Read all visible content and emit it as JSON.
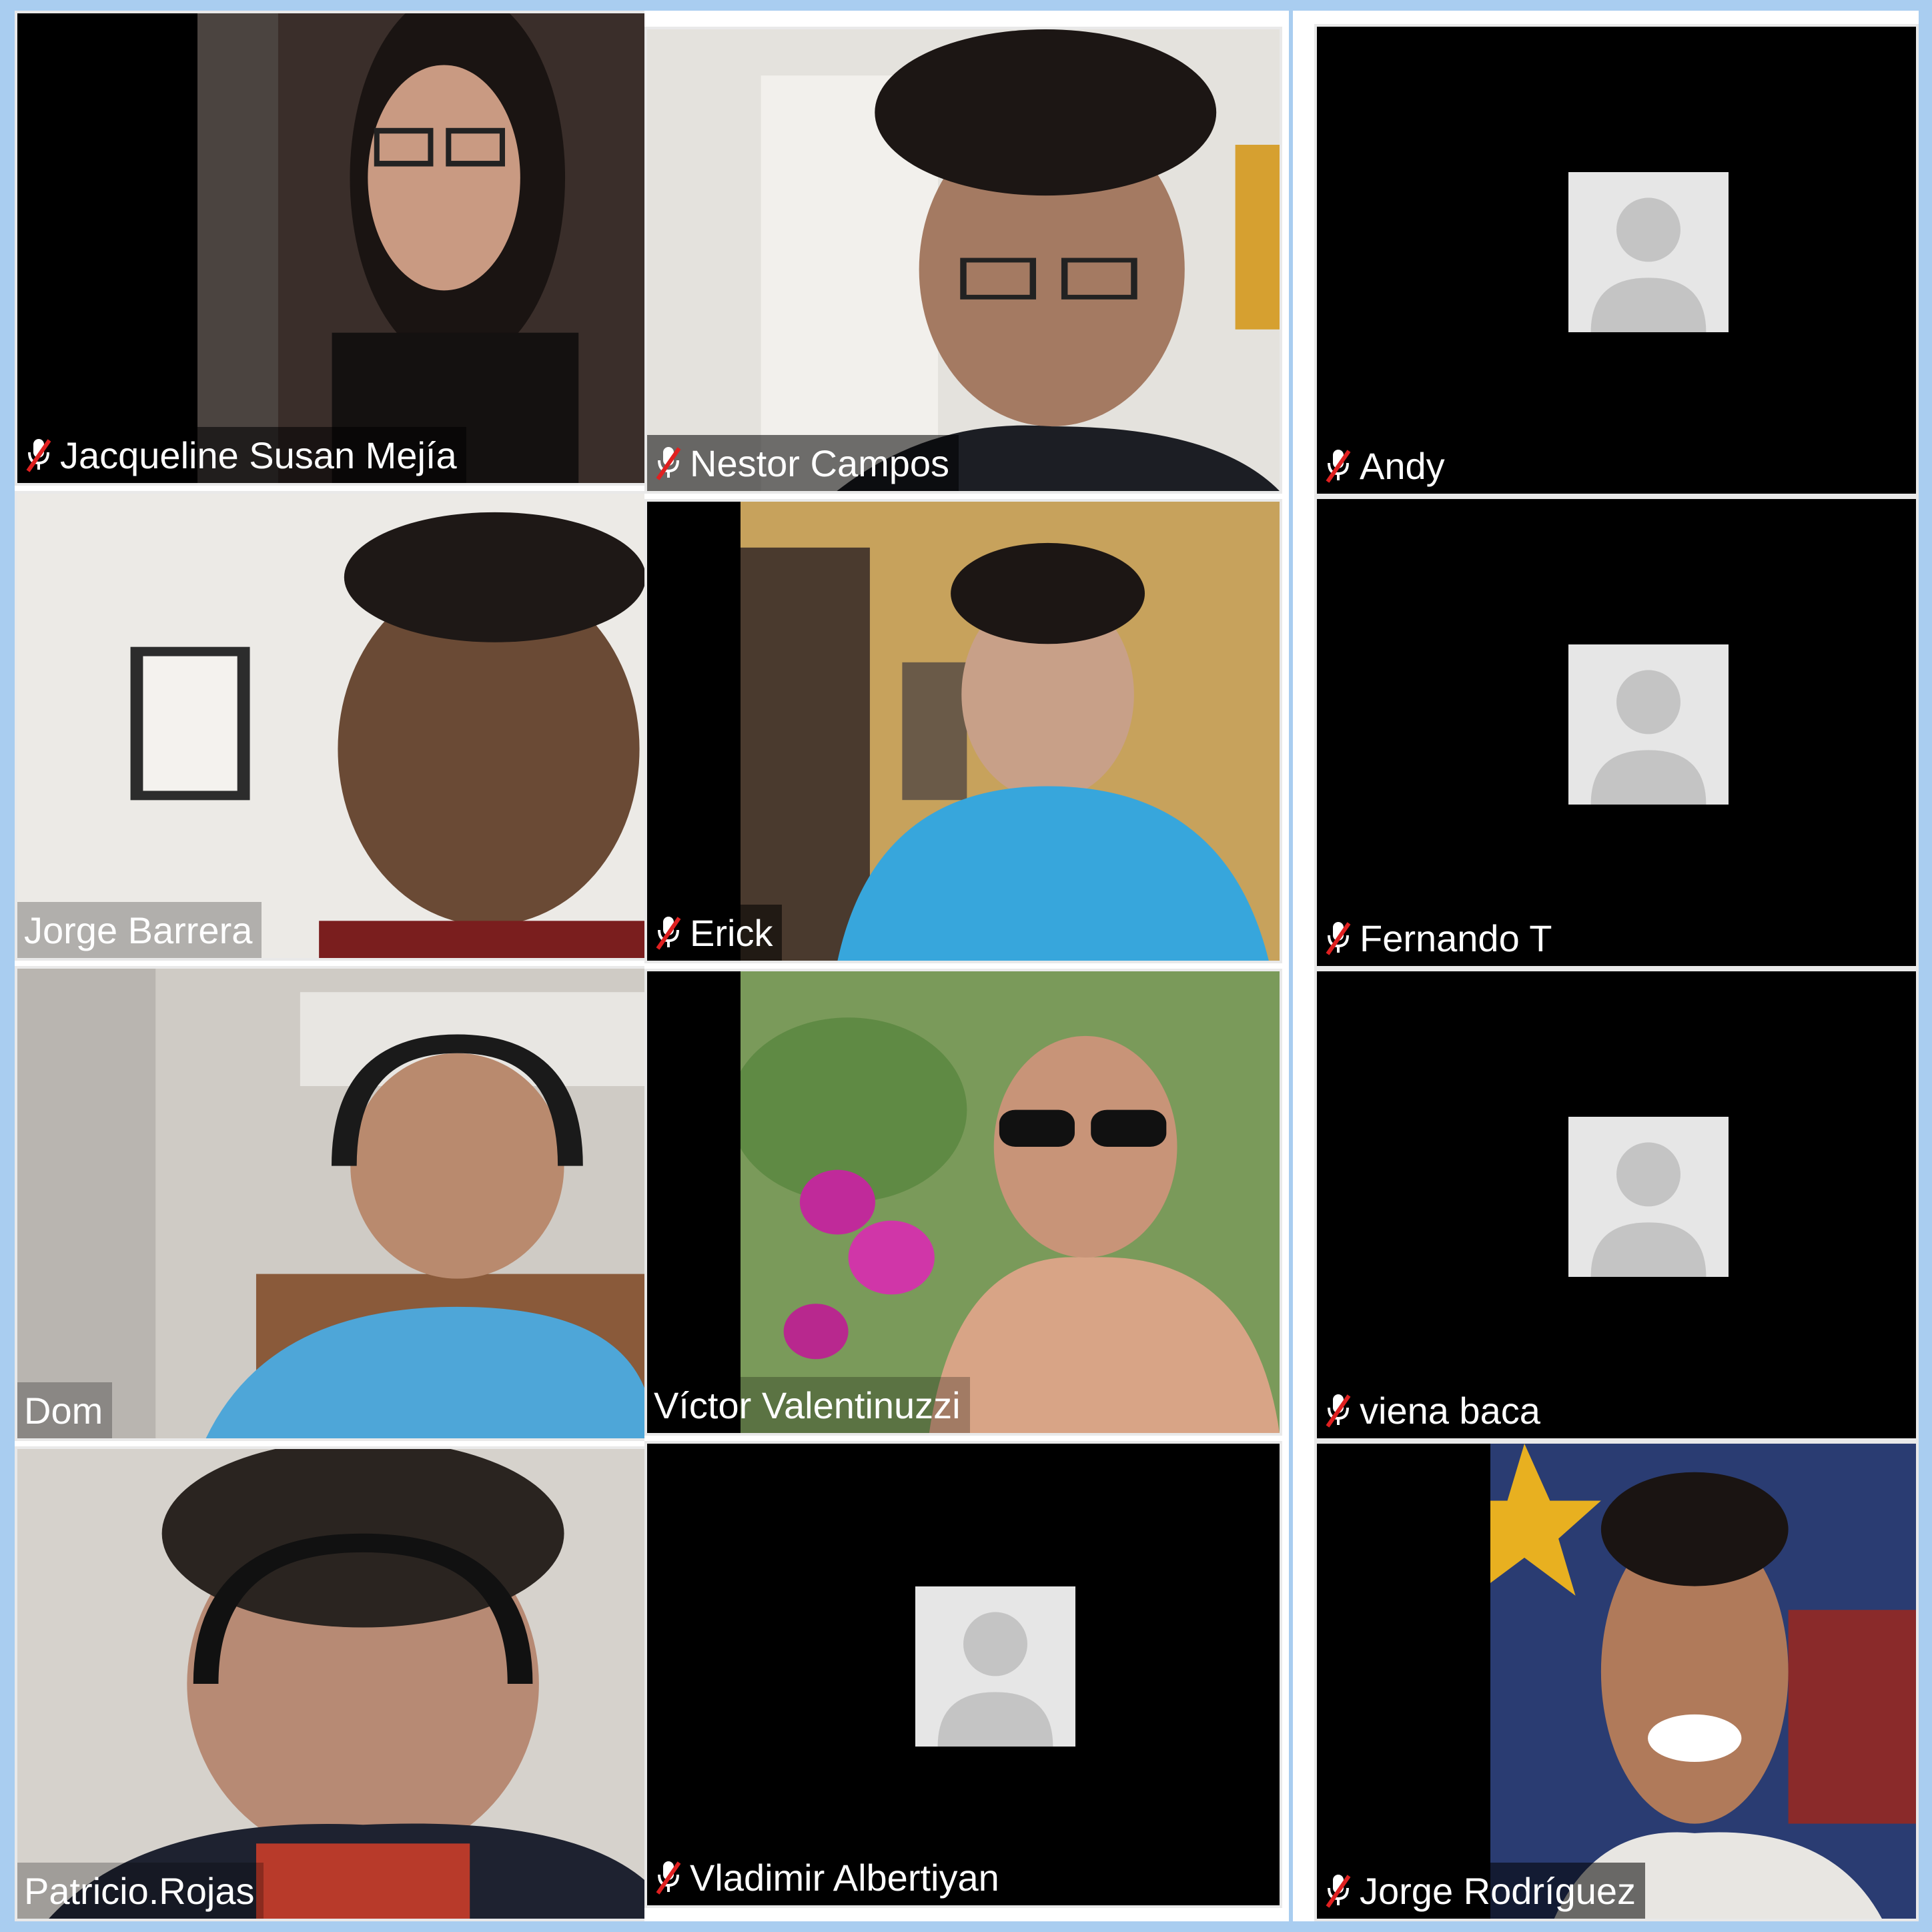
{
  "meeting": {
    "participants": [
      {
        "name": "Jacqueline Susan Mejía",
        "muted": true,
        "video": true
      },
      {
        "name": "Nestor Campos",
        "muted": true,
        "video": true
      },
      {
        "name": "Andy",
        "muted": true,
        "video": false
      },
      {
        "name": "Jorge Barrera",
        "muted": false,
        "video": true
      },
      {
        "name": "Erick",
        "muted": true,
        "video": true
      },
      {
        "name": "Fernando T",
        "muted": true,
        "video": false
      },
      {
        "name": "Dom",
        "muted": false,
        "video": true
      },
      {
        "name": "Víctor Valentinuzzi",
        "muted": false,
        "video": true
      },
      {
        "name": "viena baca",
        "muted": true,
        "video": false
      },
      {
        "name": "Patricio.Rojas",
        "muted": false,
        "video": true
      },
      {
        "name": "Vladimir Albertiyan",
        "muted": true,
        "video": false
      },
      {
        "name": "Jorge Rodríguez",
        "muted": true,
        "video": true
      }
    ]
  },
  "icons": {
    "muted_mic": "muted-microphone-icon",
    "avatar_placeholder": "avatar-placeholder-icon"
  },
  "colors": {
    "frame_background": "#a9cdf0",
    "tile_background": "#000000",
    "avatar_background": "#e6e6e6",
    "avatar_figure": "#c4c4c4",
    "mute_slash": "#e02020",
    "name_text": "#ffffff"
  }
}
